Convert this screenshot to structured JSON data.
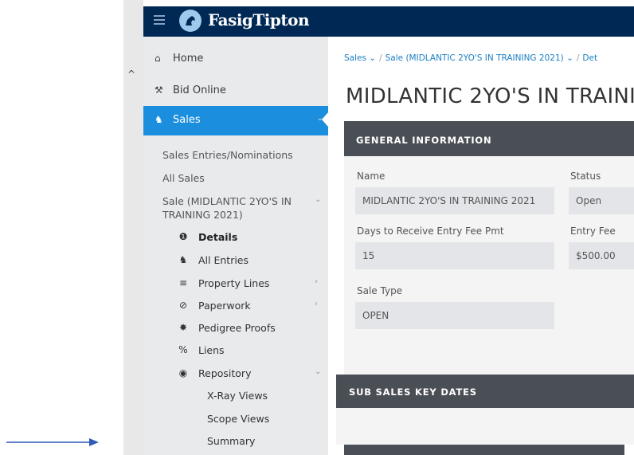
{
  "brand": {
    "name": "FasigTipton"
  },
  "sidebar": {
    "items": [
      {
        "label": "Home",
        "icon": "home-icon"
      },
      {
        "label": "Bid Online",
        "icon": "gavel-icon"
      },
      {
        "label": "Sales",
        "icon": "horse-icon",
        "active": true
      }
    ],
    "sales_sub": [
      {
        "label": "Sales Entries/Nominations"
      },
      {
        "label": "All Sales"
      },
      {
        "label": "Sale (MIDLANTIC 2YO'S IN TRAINING 2021)"
      }
    ],
    "sale_sub_line1": "Sale (MIDLANTIC 2YO'S IN",
    "sale_sub_line2": "TRAINING 2021)",
    "sale_items": [
      {
        "label": "Details",
        "icon": "info-icon",
        "active": true
      },
      {
        "label": "All Entries",
        "icon": "horse-icon"
      },
      {
        "label": "Property Lines",
        "icon": "list-icon",
        "has_children": true
      },
      {
        "label": "Paperwork",
        "icon": "paperclip-icon",
        "has_children": true
      },
      {
        "label": "Pedigree Proofs",
        "icon": "seal-icon"
      },
      {
        "label": "Liens",
        "icon": "link-icon"
      },
      {
        "label": "Repository",
        "icon": "eye-icon",
        "expanded": true
      }
    ],
    "repository_items": [
      {
        "label": "X-Ray Views"
      },
      {
        "label": "Scope Views"
      },
      {
        "label": "Summary"
      }
    ]
  },
  "breadcrumb": {
    "items": [
      "Sales",
      "Sale (MIDLANTIC 2YO'S IN TRAINING 2021)",
      "Det"
    ]
  },
  "page": {
    "title": "MIDLANTIC 2YO'S IN TRAININ"
  },
  "general": {
    "heading": "GENERAL INFORMATION",
    "name_label": "Name",
    "name_value": "MIDLANTIC 2YO'S IN TRAINING 2021",
    "status_label": "Status",
    "status_value": "Open",
    "days_label": "Days to Receive Entry Fee Pmt",
    "days_value": "15",
    "fee_label": "Entry Fee",
    "fee_value": "$500.00",
    "type_label": "Sale Type",
    "type_value": "OPEN"
  },
  "subsales": {
    "heading": "SUB SALES KEY DATES"
  },
  "colors": {
    "topbar": "#002855",
    "accent": "#1b8fdd",
    "card_head": "#4a4e55",
    "arrow": "#2f5bb7"
  }
}
